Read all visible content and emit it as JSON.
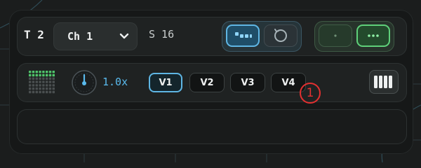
{
  "header": {
    "track_label": "T 2",
    "channel_label": "Ch 1",
    "step_label": "S 16",
    "icons": [
      "chevron-down-icon",
      "pattern-icon",
      "loop-icon",
      "dot-icon",
      "ellipsis-icon"
    ]
  },
  "controls": {
    "speed_label": "1.0x",
    "variations": [
      {
        "label": "V1",
        "active": true
      },
      {
        "label": "V2",
        "active": false
      },
      {
        "label": "V3",
        "active": false
      },
      {
        "label": "V4",
        "active": false
      }
    ],
    "icons": [
      "step-grid-icon",
      "dial-icon",
      "level-meter-icon"
    ]
  },
  "annotation": {
    "marker_label": "1"
  },
  "colors": {
    "accent_blue": "#5fb6e4",
    "accent_green": "#5fd07a",
    "marker_red": "#e23030",
    "grid_green": "#4fc36a"
  }
}
